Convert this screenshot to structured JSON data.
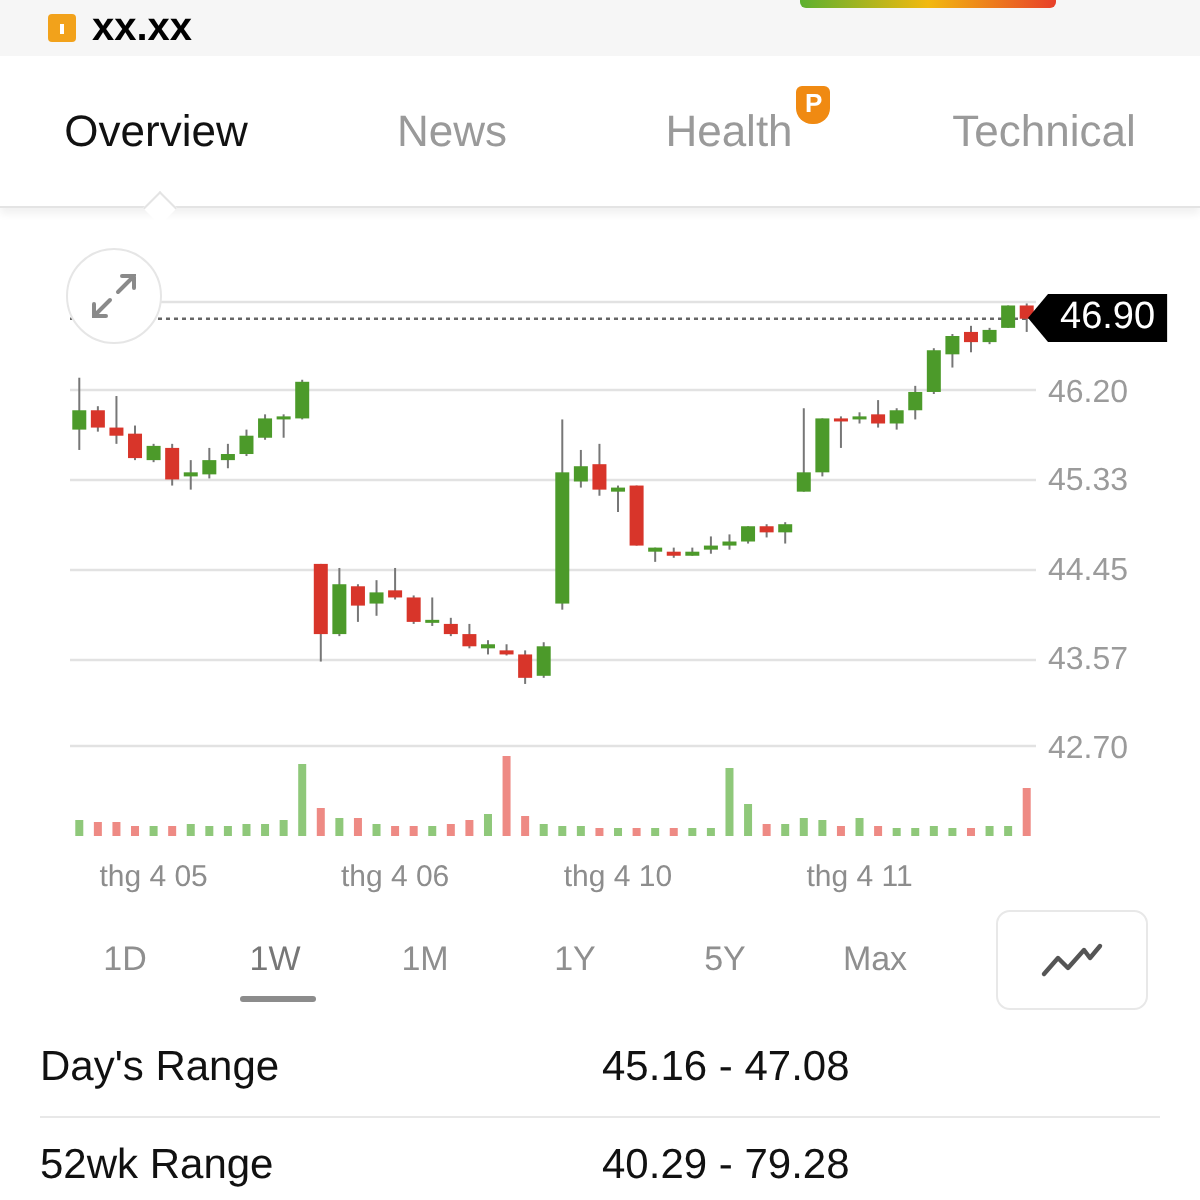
{
  "header": {
    "price": "xx.xx"
  },
  "tabs": [
    {
      "label": "Overview",
      "selected": true
    },
    {
      "label": "News",
      "selected": false
    },
    {
      "label": "Health",
      "selected": false,
      "badge": "P"
    },
    {
      "label": "Technical",
      "selected": false
    }
  ],
  "chart": {
    "current_price": "46.90",
    "chart_data": {
      "type": "candlestick",
      "yticks": [
        {
          "value": 46.2,
          "label": "46.20"
        },
        {
          "value": 45.33,
          "label": "45.33"
        },
        {
          "value": 44.45,
          "label": "44.45"
        },
        {
          "value": 43.57,
          "label": "43.57"
        },
        {
          "value": 42.7,
          "label": "42.70"
        }
      ],
      "ylim": [
        42.7,
        47.08
      ],
      "grid": true,
      "ref_lines": [
        {
          "axis": "y",
          "value": 46.9
        }
      ],
      "categories": [
        null,
        null,
        null,
        null,
        "thg 4 05",
        null,
        null,
        null,
        null,
        null,
        null,
        null,
        null,
        null,
        null,
        null,
        null,
        "thg 4 06",
        null,
        null,
        null,
        null,
        null,
        null,
        null,
        null,
        null,
        null,
        null,
        "thg 4 10",
        null,
        null,
        null,
        null,
        null,
        null,
        null,
        null,
        null,
        null,
        null,
        null,
        "thg 4 11",
        null,
        null,
        null,
        null,
        null,
        null,
        null,
        null,
        null
      ],
      "ohlc": [
        [
          45.81,
          46.32,
          45.61,
          46.0
        ],
        [
          46.0,
          46.04,
          45.79,
          45.83
        ],
        [
          45.83,
          46.14,
          45.67,
          45.75
        ],
        [
          45.77,
          45.85,
          45.51,
          45.53
        ],
        [
          45.51,
          45.67,
          45.49,
          45.65
        ],
        [
          45.63,
          45.67,
          45.26,
          45.32
        ],
        [
          45.35,
          45.51,
          45.22,
          45.39
        ],
        [
          45.37,
          45.63,
          45.33,
          45.51
        ],
        [
          45.51,
          45.67,
          45.43,
          45.57
        ],
        [
          45.57,
          45.81,
          45.55,
          45.75
        ],
        [
          45.73,
          45.96,
          45.71,
          45.92
        ],
        [
          45.91,
          45.96,
          45.73,
          45.94
        ],
        [
          45.92,
          46.3,
          45.91,
          46.28
        ],
        [
          44.49,
          44.49,
          43.53,
          43.8
        ],
        [
          43.8,
          44.45,
          43.78,
          44.29
        ],
        [
          44.27,
          44.29,
          43.92,
          44.08
        ],
        [
          44.1,
          44.33,
          43.98,
          44.21
        ],
        [
          44.23,
          44.45,
          44.14,
          44.16
        ],
        [
          44.16,
          44.18,
          43.9,
          43.92
        ],
        [
          43.92,
          44.16,
          43.88,
          43.94
        ],
        [
          43.9,
          43.96,
          43.78,
          43.8
        ],
        [
          43.8,
          43.9,
          43.66,
          43.68
        ],
        [
          43.66,
          43.74,
          43.6,
          43.7
        ],
        [
          43.64,
          43.7,
          43.59,
          43.6
        ],
        [
          43.6,
          43.64,
          43.31,
          43.37
        ],
        [
          43.39,
          43.72,
          43.37,
          43.68
        ],
        [
          44.1,
          45.91,
          44.04,
          45.39
        ],
        [
          45.3,
          45.61,
          45.24,
          45.45
        ],
        [
          45.47,
          45.67,
          45.16,
          45.22
        ],
        [
          45.2,
          45.26,
          45.0,
          45.24
        ],
        [
          45.26,
          45.26,
          44.67,
          44.67
        ],
        [
          44.61,
          44.65,
          44.51,
          44.65
        ],
        [
          44.61,
          44.65,
          44.55,
          44.57
        ],
        [
          44.57,
          44.65,
          44.57,
          44.61
        ],
        [
          44.63,
          44.76,
          44.59,
          44.67
        ],
        [
          44.67,
          44.78,
          44.63,
          44.71
        ],
        [
          44.71,
          44.86,
          44.69,
          44.86
        ],
        [
          44.86,
          44.88,
          44.75,
          44.8
        ],
        [
          44.8,
          44.9,
          44.69,
          44.88
        ],
        [
          45.2,
          46.02,
          45.2,
          45.39
        ],
        [
          45.39,
          45.92,
          45.35,
          45.92
        ],
        [
          45.92,
          45.94,
          45.63,
          45.89
        ],
        [
          45.91,
          45.98,
          45.87,
          45.94
        ],
        [
          45.96,
          46.1,
          45.83,
          45.87
        ],
        [
          45.87,
          46.02,
          45.81,
          46.0
        ],
        [
          46.0,
          46.24,
          45.91,
          46.18
        ],
        [
          46.18,
          46.61,
          46.16,
          46.59
        ],
        [
          46.55,
          46.75,
          46.42,
          46.73
        ],
        [
          46.77,
          46.83,
          46.57,
          46.67
        ],
        [
          46.67,
          46.81,
          46.65,
          46.79
        ],
        [
          46.81,
          47.03,
          46.81,
          47.03
        ],
        [
          47.03,
          47.05,
          46.77,
          46.9
        ]
      ]
    }
  },
  "ranges": [
    {
      "label": "1D",
      "selected": false
    },
    {
      "label": "1W",
      "selected": true
    },
    {
      "label": "1M",
      "selected": false
    },
    {
      "label": "1Y",
      "selected": false
    },
    {
      "label": "5Y",
      "selected": false
    },
    {
      "label": "Max",
      "selected": false
    }
  ],
  "stats": [
    {
      "label": "Day's Range",
      "value": "45.16 - 47.08"
    },
    {
      "label": "52wk Range",
      "value": "40.29 - 79.28"
    }
  ]
}
